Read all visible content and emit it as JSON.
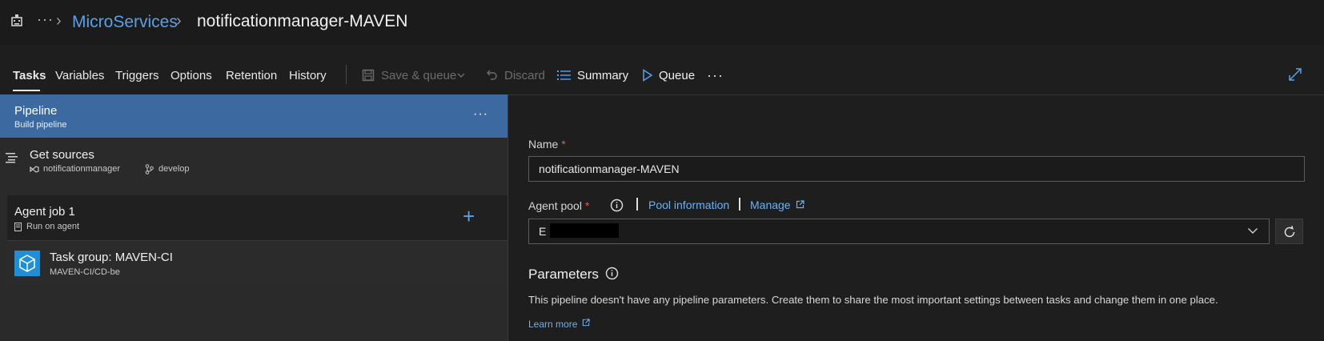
{
  "header": {
    "app_icon": "azure-devops-pipelines-icon",
    "more_icon": "ellipsis-icon",
    "crumbs": [
      "MicroServices"
    ],
    "title": "notificationmanager-MAVEN"
  },
  "tabs": [
    {
      "label": "Tasks",
      "active": true
    },
    {
      "label": "Variables",
      "active": false
    },
    {
      "label": "Triggers",
      "active": false
    },
    {
      "label": "Options",
      "active": false
    },
    {
      "label": "Retention",
      "active": false
    },
    {
      "label": "History",
      "active": false
    }
  ],
  "toolbar": {
    "save_queue_label": "Save & queue",
    "discard_label": "Discard",
    "summary_label": "Summary",
    "queue_label": "Queue",
    "more_label": "···"
  },
  "pipeline": {
    "title": "Pipeline",
    "subtitle": "Build pipeline",
    "more_label": "···"
  },
  "get_sources": {
    "title": "Get sources",
    "repo": "notificationmanager",
    "branch": "develop"
  },
  "agent_job": {
    "title": "Agent job 1",
    "subtitle": "Run on agent",
    "add_label": "+"
  },
  "task_group": {
    "title": "Task group: MAVEN-CI",
    "subtitle": "MAVEN-CI/CD-be"
  },
  "form": {
    "name_label": "Name",
    "required_mark": "*",
    "name_value": "notificationmanager-MAVEN",
    "agent_pool_label": "Agent pool",
    "pool_info_link": "Pool information",
    "manage_link": "Manage",
    "pool_value": "E",
    "parameters_title": "Parameters",
    "parameters_text": "This pipeline doesn't have any pipeline parameters. Create them to share the most important settings between tasks and change them in one place.",
    "learn_more_link": "Learn more"
  },
  "colors": {
    "accent": "#3c6aa0",
    "link": "#5aa0e8",
    "required": "#e05a5a"
  }
}
